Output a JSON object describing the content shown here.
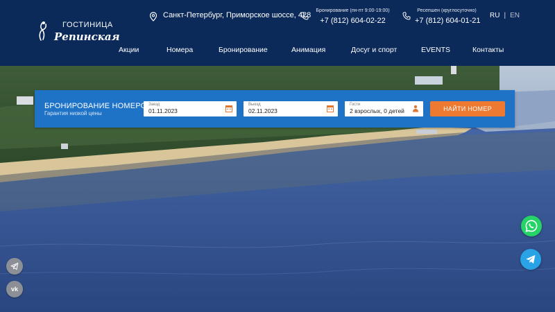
{
  "header": {
    "logo": {
      "top": "ГОСТИНИЦА",
      "main": "Репинская"
    },
    "address": "Санкт-Петербург, Приморское шоссе, 428",
    "booking_phone": {
      "label": "Бронирование (пн-пт 9:00-19:00)",
      "number": "+7 (812) 604-02-22"
    },
    "reception_phone": {
      "label": "Ресепшен (круглосуточно)",
      "number": "+7 (812) 604-01-21"
    },
    "lang": {
      "ru": "RU",
      "sep": "|",
      "en": "EN"
    }
  },
  "nav": {
    "items": [
      {
        "label": "Акции"
      },
      {
        "label": "Номера"
      },
      {
        "label": "Бронирование"
      },
      {
        "label": "Анимация"
      },
      {
        "label": "Досуг и спорт"
      },
      {
        "label": "EVENTS"
      },
      {
        "label": "Контакты"
      }
    ]
  },
  "booking": {
    "title": "БРОНИРОВАНИЕ НОМЕРОВ",
    "subtitle": "Гарантия низкой цены",
    "checkin": {
      "label": "Заезд",
      "value": "01.11.2023"
    },
    "checkout": {
      "label": "Выезд",
      "value": "02.11.2023"
    },
    "guests": {
      "label": "Гости",
      "value": "2 взрослых, 0 детей"
    },
    "button": "НАЙТИ НОМЕР"
  },
  "social": {
    "left": [
      "telegram-icon",
      "vk-icon"
    ],
    "vk_text": "vk",
    "right": [
      "whatsapp-icon",
      "telegram-icon"
    ]
  },
  "colors": {
    "header_bg": "#0b2a5a",
    "booking_bg": "#1f73c7",
    "button_bg": "#ee7a32",
    "whatsapp": "#25d366",
    "telegram": "#2aa3e6"
  }
}
